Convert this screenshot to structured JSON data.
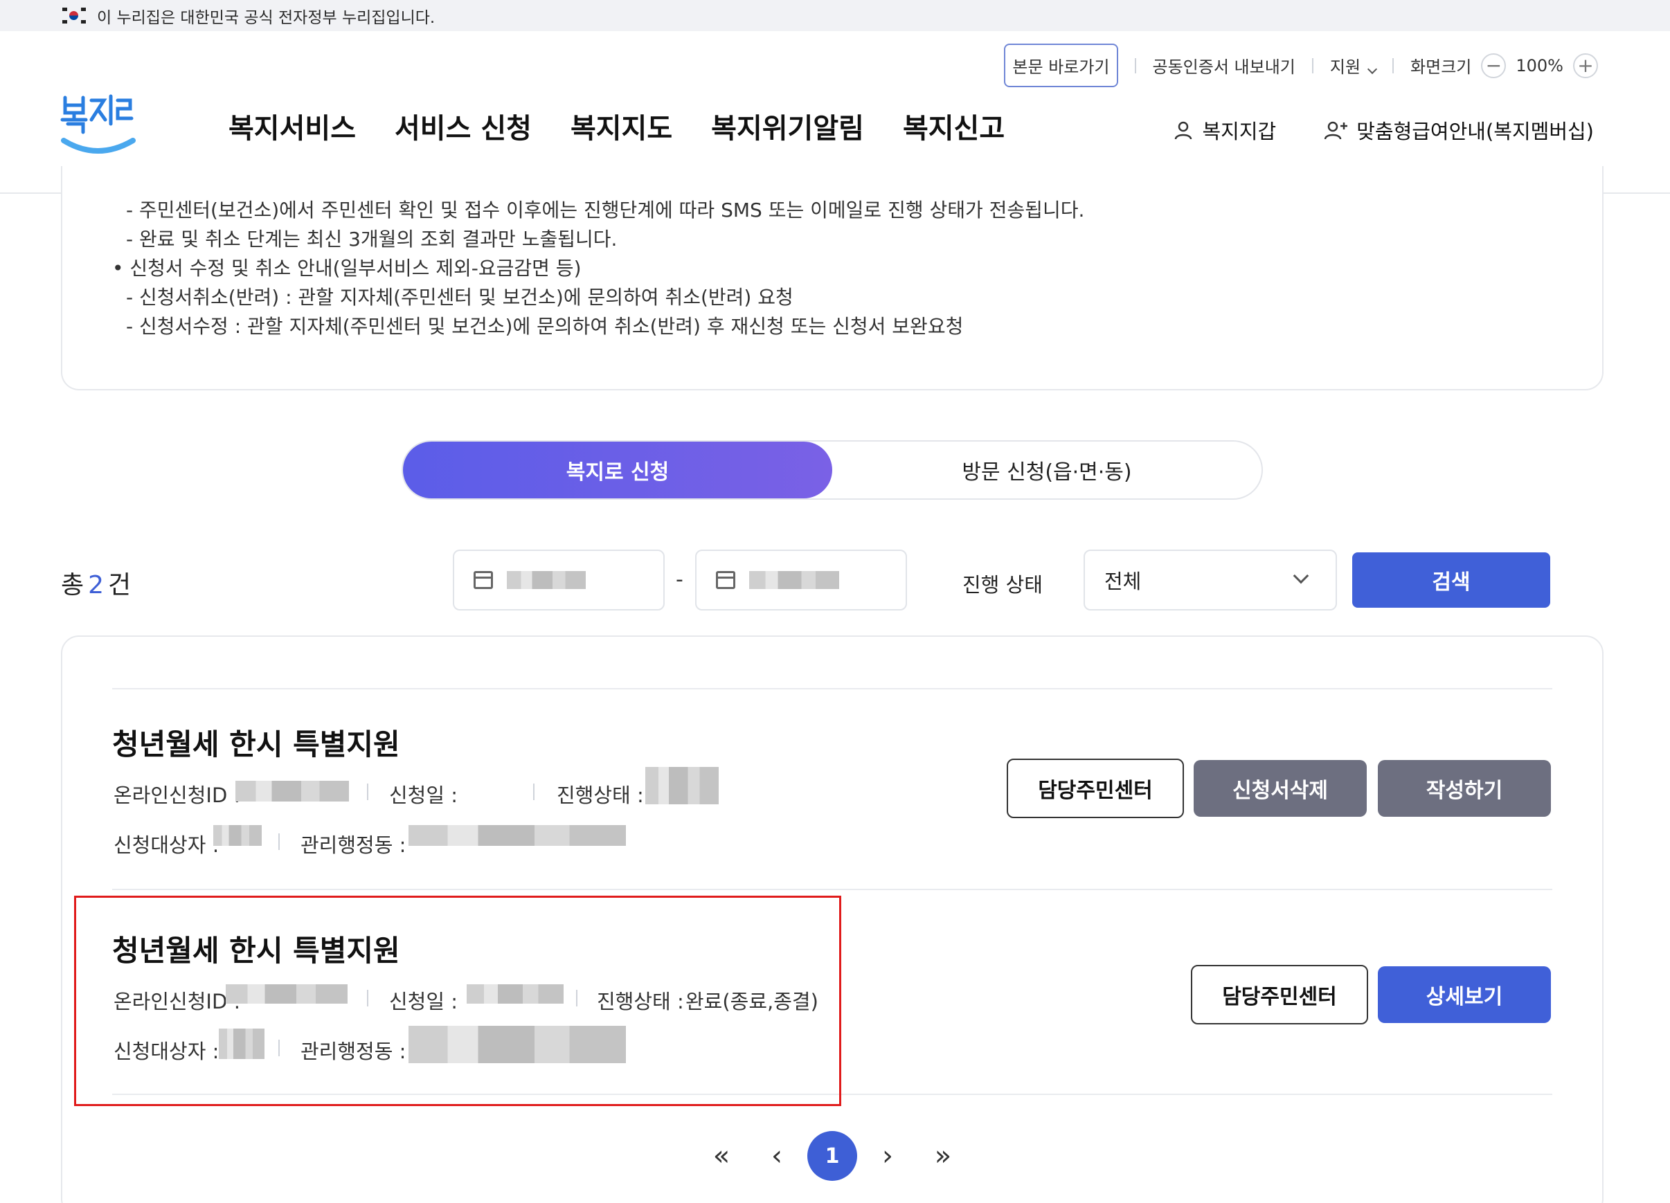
{
  "gov_banner": {
    "text": "이 누리집은 대한민국 공식 전자정부 누리집입니다."
  },
  "util": {
    "skip": "본문 바로가기",
    "cert": "공동인증서 내보내기",
    "support": "지원",
    "screen_size": "화면크기",
    "zoom_minus": "−",
    "zoom_value": "100%",
    "zoom_plus": "+"
  },
  "nav": {
    "items": [
      "복지서비스",
      "서비스 신청",
      "복지지도",
      "복지위기알림",
      "복지신고"
    ]
  },
  "my": {
    "wallet": "복지지갑",
    "membership": "맞춤형급여안내(복지멤버십)"
  },
  "notice": {
    "lines": [
      "- 주민센터(보건소)에서 주민센터 확인 및 접수 이후에는 진행단계에 따라 SMS 또는 이메일로 진행 상태가 전송됩니다.",
      "- 완료 및 취소 단계는 최신 3개월의 조회 결과만 노출됩니다.",
      "• 신청서 수정 및 취소 안내(일부서비스 제외-요금감면 등)",
      "- 신청서취소(반려) : 관할 지자체(주민센터 및 보건소)에 문의하여 취소(반려) 요청",
      "- 신청서수정 : 관할 지자체(주민센터 및 보건소)에 문의하여 취소(반려) 후 재신청 또는 신청서 보완요청"
    ]
  },
  "tabs": [
    {
      "label": "복지로 신청",
      "active": true
    },
    {
      "label": "방문 신청(읍·면·동)",
      "active": false
    }
  ],
  "filter": {
    "total_prefix": "총",
    "total_count": "2",
    "total_suffix": "건",
    "date_dash": "-",
    "status_label": "진행 상태",
    "status_value": "전체",
    "search_label": "검색"
  },
  "cards": [
    {
      "title": "청년월세 한시 특별지원",
      "online_id_label": "온라인신청ID :",
      "apply_date_label": "신청일 :",
      "status_label": "진행상태 :",
      "status_value": "",
      "target_label": "신청대상자 :",
      "office_label": "관리행정동 :",
      "buttons": [
        "담당주민센터",
        "신청서삭제",
        "작성하기"
      ]
    },
    {
      "title": "청년월세 한시 특별지원",
      "online_id_label": "온라인신청ID :",
      "apply_date_label": "신청일 :",
      "status_label": "진행상태 :",
      "status_value": "완료(종료,종결)",
      "target_label": "신청대상자 :",
      "office_label": "관리행정동 :",
      "buttons": [
        "담당주민센터",
        "상세보기"
      ]
    }
  ],
  "pagination": {
    "first": "«",
    "prev": "‹",
    "current": "1",
    "next": "›",
    "last": "»"
  },
  "colors": {
    "accent": "#4060d8",
    "tab_gradient_start": "#5b5de8",
    "tab_gradient_end": "#7a61e6",
    "highlight": "#e01b1b",
    "gray_button": "#6d6f80"
  }
}
